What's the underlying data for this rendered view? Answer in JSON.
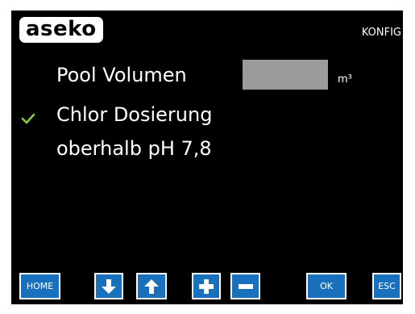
{
  "header": {
    "logo_text": "aseko",
    "mode_label": "KONFIG"
  },
  "settings": {
    "pool_volume_label": "Pool Volumen",
    "pool_volume_value": "",
    "pool_volume_unit": "m³",
    "chlor_dosing_line1": "Chlor Dosierung",
    "chlor_dosing_line2": "oberhalb pH 7,8",
    "chlor_dosing_checked": true
  },
  "toolbar": {
    "home_label": "HOME",
    "down_icon": "arrow-down-icon",
    "up_icon": "arrow-up-icon",
    "plus_icon": "plus-icon",
    "minus_icon": "minus-icon",
    "ok_label": "OK",
    "esc_label": "ESC"
  },
  "colors": {
    "screen_bg": "#000000",
    "button_blue": "#1971bd",
    "check_green": "#8dc63f",
    "input_gray": "#9b9b9b"
  }
}
